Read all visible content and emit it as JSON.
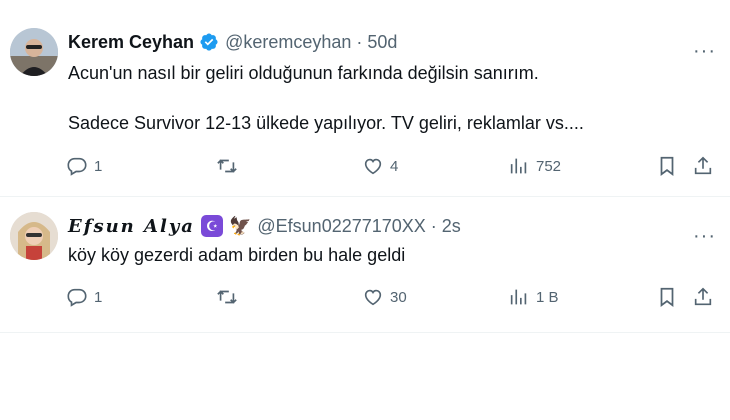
{
  "tweets": [
    {
      "name": "Kerem Ceyhan",
      "handle": "@keremceyhan",
      "separator": "·",
      "time": "50d",
      "verified": true,
      "text_lines": [
        "Acun'un nasıl bir geliri olduğunun farkında değilsin sanırım.",
        "Sadece Survivor 12-13 ülkede yapılıyor. TV geliri, reklamlar vs...."
      ],
      "more": "···",
      "actions": {
        "reply": "1",
        "retweet": "",
        "like": "4",
        "views": "752"
      }
    },
    {
      "name": "Efsun Alya",
      "emoji_crescent": "☪",
      "emoji_eagle": "🦅",
      "handle": "@Efsun02277170XX",
      "separator": "·",
      "time": "2s",
      "text_lines": [
        "köy köy gezerdi adam birden bu hale geldi"
      ],
      "more": "···",
      "actions": {
        "reply": "1",
        "retweet": "",
        "like": "30",
        "views": "1 B"
      }
    }
  ],
  "colors": {
    "verified": "#1d9bf0",
    "muted": "#536471",
    "text": "#0f1419",
    "crescent_bg": "#7a4ad8"
  }
}
